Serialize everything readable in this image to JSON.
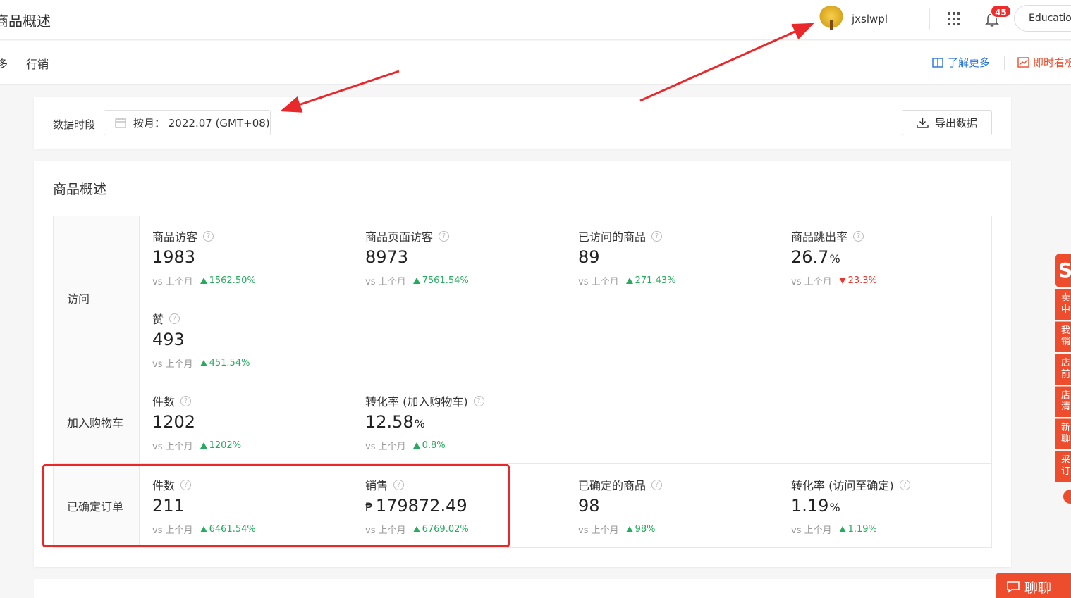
{
  "header": {
    "page_title": "商品概述",
    "username": "jxslwpl",
    "notification_count": "45",
    "education_label": "Education"
  },
  "subnav": {
    "cut_label": "多",
    "tab_label": "行销",
    "learn_more": "了解更多",
    "realtime": "即时看板"
  },
  "period": {
    "label": "数据时段",
    "picker_value": "按月： 2022.07 (GMT+08)",
    "export_label": "导出数据"
  },
  "overview": {
    "title": "商品概述",
    "compare_label": "vs 上个月",
    "rows": [
      {
        "label": "访问",
        "metrics": [
          {
            "name": "商品访客",
            "value": "1983",
            "change": "1562.50%",
            "direction": "up"
          },
          {
            "name": "商品页面访客",
            "value": "8973",
            "change": "7561.54%",
            "direction": "up"
          },
          {
            "name": "已访问的商品",
            "value": "89",
            "change": "271.43%",
            "direction": "up"
          },
          {
            "name": "商品跳出率",
            "value": "26.7",
            "unit": "%",
            "change": "23.3%",
            "direction": "down"
          },
          {
            "name": "赞",
            "value": "493",
            "change": "451.54%",
            "direction": "up"
          }
        ]
      },
      {
        "label": "加入购物车",
        "metrics": [
          {
            "name": "件数",
            "value": "1202",
            "change": "1202%",
            "direction": "up"
          },
          {
            "name": "转化率 (加入购物车)",
            "value": "12.58",
            "unit": "%",
            "change": "0.8%",
            "direction": "up"
          }
        ]
      },
      {
        "label": "已确定订单",
        "metrics": [
          {
            "name": "件数",
            "value": "211",
            "change": "6461.54%",
            "direction": "up"
          },
          {
            "name": "销售",
            "currency": "₱",
            "value": "179872.49",
            "change": "6769.02%",
            "direction": "up"
          },
          {
            "name": "已确定的商品",
            "value": "98",
            "change": "98%",
            "direction": "up"
          },
          {
            "name": "转化率 (访问至确定)",
            "value": "1.19",
            "unit": "%",
            "change": "1.19%",
            "direction": "up"
          }
        ]
      }
    ]
  },
  "sidebar_float": {
    "logo": "S",
    "items": [
      "卖中",
      "我销",
      "店前",
      "店清",
      "新聊",
      "采订"
    ]
  },
  "chat_button": "聊聊",
  "colors": {
    "brand": "#ee4d2d",
    "link": "#2673dd",
    "positive": "#26aa5e",
    "negative": "#e8382d",
    "annotation": "#e8282b"
  }
}
